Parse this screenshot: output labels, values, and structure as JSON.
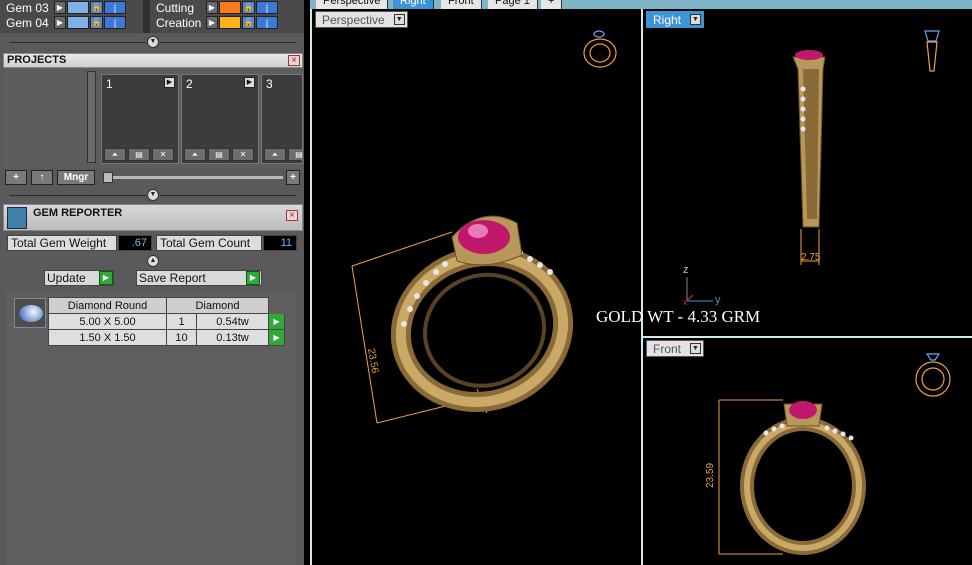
{
  "layers": [
    {
      "name": "Gem 03",
      "swatch": "#7fb0e6"
    },
    {
      "name": "Gem 04",
      "swatch": "#7fb0e6"
    },
    {
      "name": "Cutting",
      "swatch": "#ff7a1a"
    },
    {
      "name": "Creation",
      "swatch": "#ffb21a"
    }
  ],
  "projects": {
    "title": "PROJECTS",
    "slots": [
      "1",
      "2",
      "3"
    ],
    "buttons": {
      "add": "+",
      "up": "↑",
      "manager": "Mngr",
      "plus": "+"
    }
  },
  "gem_reporter": {
    "title": "GEM REPORTER",
    "total_weight_label": "Total Gem Weight",
    "total_weight_value": ".67",
    "total_count_label": "Total Gem Count",
    "total_count_value": "11",
    "update_label": "Update",
    "save_label": "Save Report",
    "table": {
      "headers": [
        "Diamond Round",
        "Diamond"
      ],
      "rows": [
        {
          "size": "5.00 X 5.00",
          "count": "1",
          "weight": "0.54tw"
        },
        {
          "size": "1.50 X 1.50",
          "count": "10",
          "weight": "0.13tw"
        }
      ]
    }
  },
  "tabs": [
    "Perspective",
    "Right",
    "Front",
    "Page 1",
    "+"
  ],
  "viewports": {
    "perspective": {
      "label": "Perspective",
      "dimension": "23.56"
    },
    "right": {
      "label": "Right",
      "dimension": "2.75",
      "axis_z": "z",
      "axis_y": "y",
      "axis_x": "x"
    },
    "front": {
      "label": "Front",
      "dimension": "23.59"
    }
  },
  "annotation": "GOLD WT - 4.33 GRM",
  "colors": {
    "gold": "#b8985a",
    "ruby": "#c2186b",
    "accent": "#3b94d6",
    "dimension": "#f0a040"
  }
}
